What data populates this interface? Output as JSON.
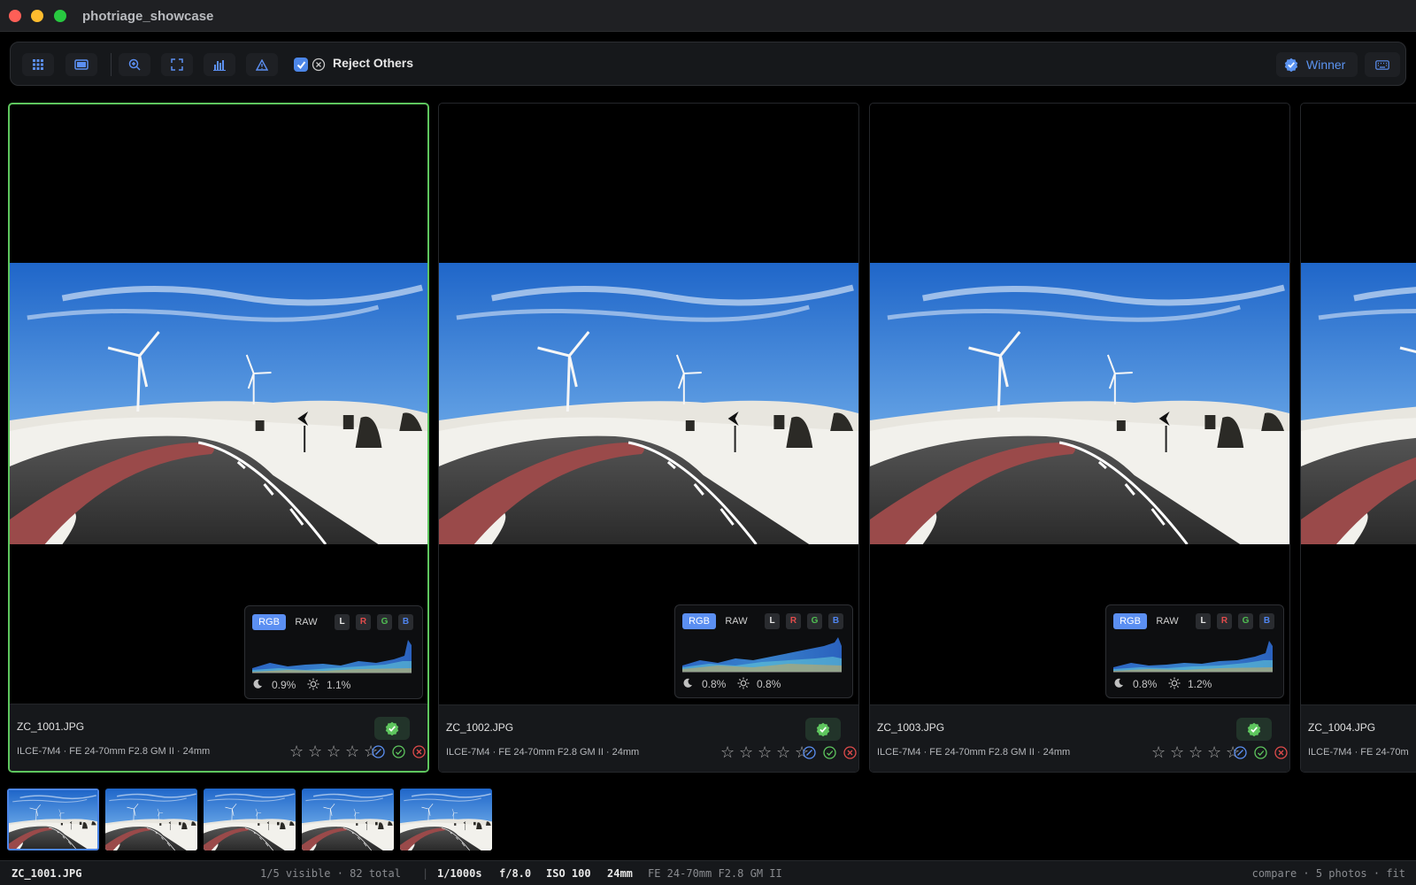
{
  "window": {
    "title": "photriage_showcase"
  },
  "toolbar": {
    "buttons": [
      "grid-icon",
      "single-view-icon",
      "zoom-icon",
      "fullscreen-icon",
      "histogram-icon",
      "warning-icon"
    ],
    "reject_others_label": "Reject Others",
    "reject_others_checked": true,
    "winner_label": "Winner"
  },
  "histogram_labels": {
    "rgb": "RGB",
    "raw": "RAW",
    "l": "L",
    "r": "R",
    "g": "G",
    "b": "B"
  },
  "cards": [
    {
      "file": "ZC_1001.JPG",
      "meta": "ILCE-7M4 · FE 24-70mm F2.8 GM II · 24mm",
      "shadow_clip": "0.9%",
      "highlight_clip": "1.1%",
      "picked": true,
      "selected": true,
      "rating": 0
    },
    {
      "file": "ZC_1002.JPG",
      "meta": "ILCE-7M4 · FE 24-70mm F2.8 GM II · 24mm",
      "shadow_clip": "0.8%",
      "highlight_clip": "0.8%",
      "picked": true,
      "selected": false,
      "rating": 0
    },
    {
      "file": "ZC_1003.JPG",
      "meta": "ILCE-7M4 · FE 24-70mm F2.8 GM II · 24mm",
      "shadow_clip": "0.8%",
      "highlight_clip": "1.2%",
      "picked": true,
      "selected": false,
      "rating": 0
    },
    {
      "file": "ZC_1004.JPG",
      "meta": "ILCE-7M4 · FE 24-70m",
      "picked": false,
      "selected": false,
      "rating": 0
    }
  ],
  "filmstrip": {
    "count": 5,
    "active_index": 0
  },
  "status": {
    "file": "ZC_1001.JPG",
    "visibility": "1/5 visible · 82 total",
    "divider": "|",
    "exposure": "1/1000s",
    "aperture": "f/8.0",
    "iso": "ISO 100",
    "focal": "24mm",
    "lens": "FE 24-70mm F2.8 GM II",
    "mode": "compare · 5 photos · fit"
  },
  "colors": {
    "accent": "#4c86e8",
    "pick": "#5ec65e",
    "reject": "#e04b4b"
  }
}
